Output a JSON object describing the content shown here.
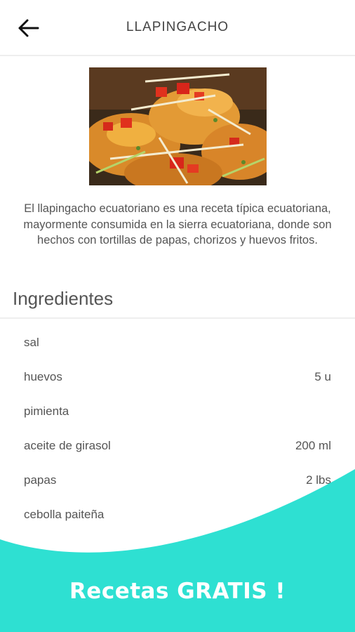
{
  "header": {
    "title": "LLAPINGACHO",
    "back_icon": "arrow-left-icon"
  },
  "recipe": {
    "description": "El llapingacho ecuatoriano es una receta típica ecuatoriana, mayormente consumida en la sierra ecuatoriana, donde son hechos con tortillas de papas, chorizos y huevos fritos."
  },
  "ingredients": {
    "title": "Ingredientes",
    "items": [
      {
        "name": "sal",
        "qty": ""
      },
      {
        "name": "huevos",
        "qty": "5 u"
      },
      {
        "name": "pimienta",
        "qty": ""
      },
      {
        "name": "aceite de girasol",
        "qty": "200 ml"
      },
      {
        "name": "papas",
        "qty": "2 lbs"
      },
      {
        "name": "cebolla paiteña",
        "qty": ""
      }
    ]
  },
  "promo": {
    "label": "Recetas GRATIS !"
  },
  "colors": {
    "accent": "#2ee0d2",
    "text": "#555555"
  }
}
